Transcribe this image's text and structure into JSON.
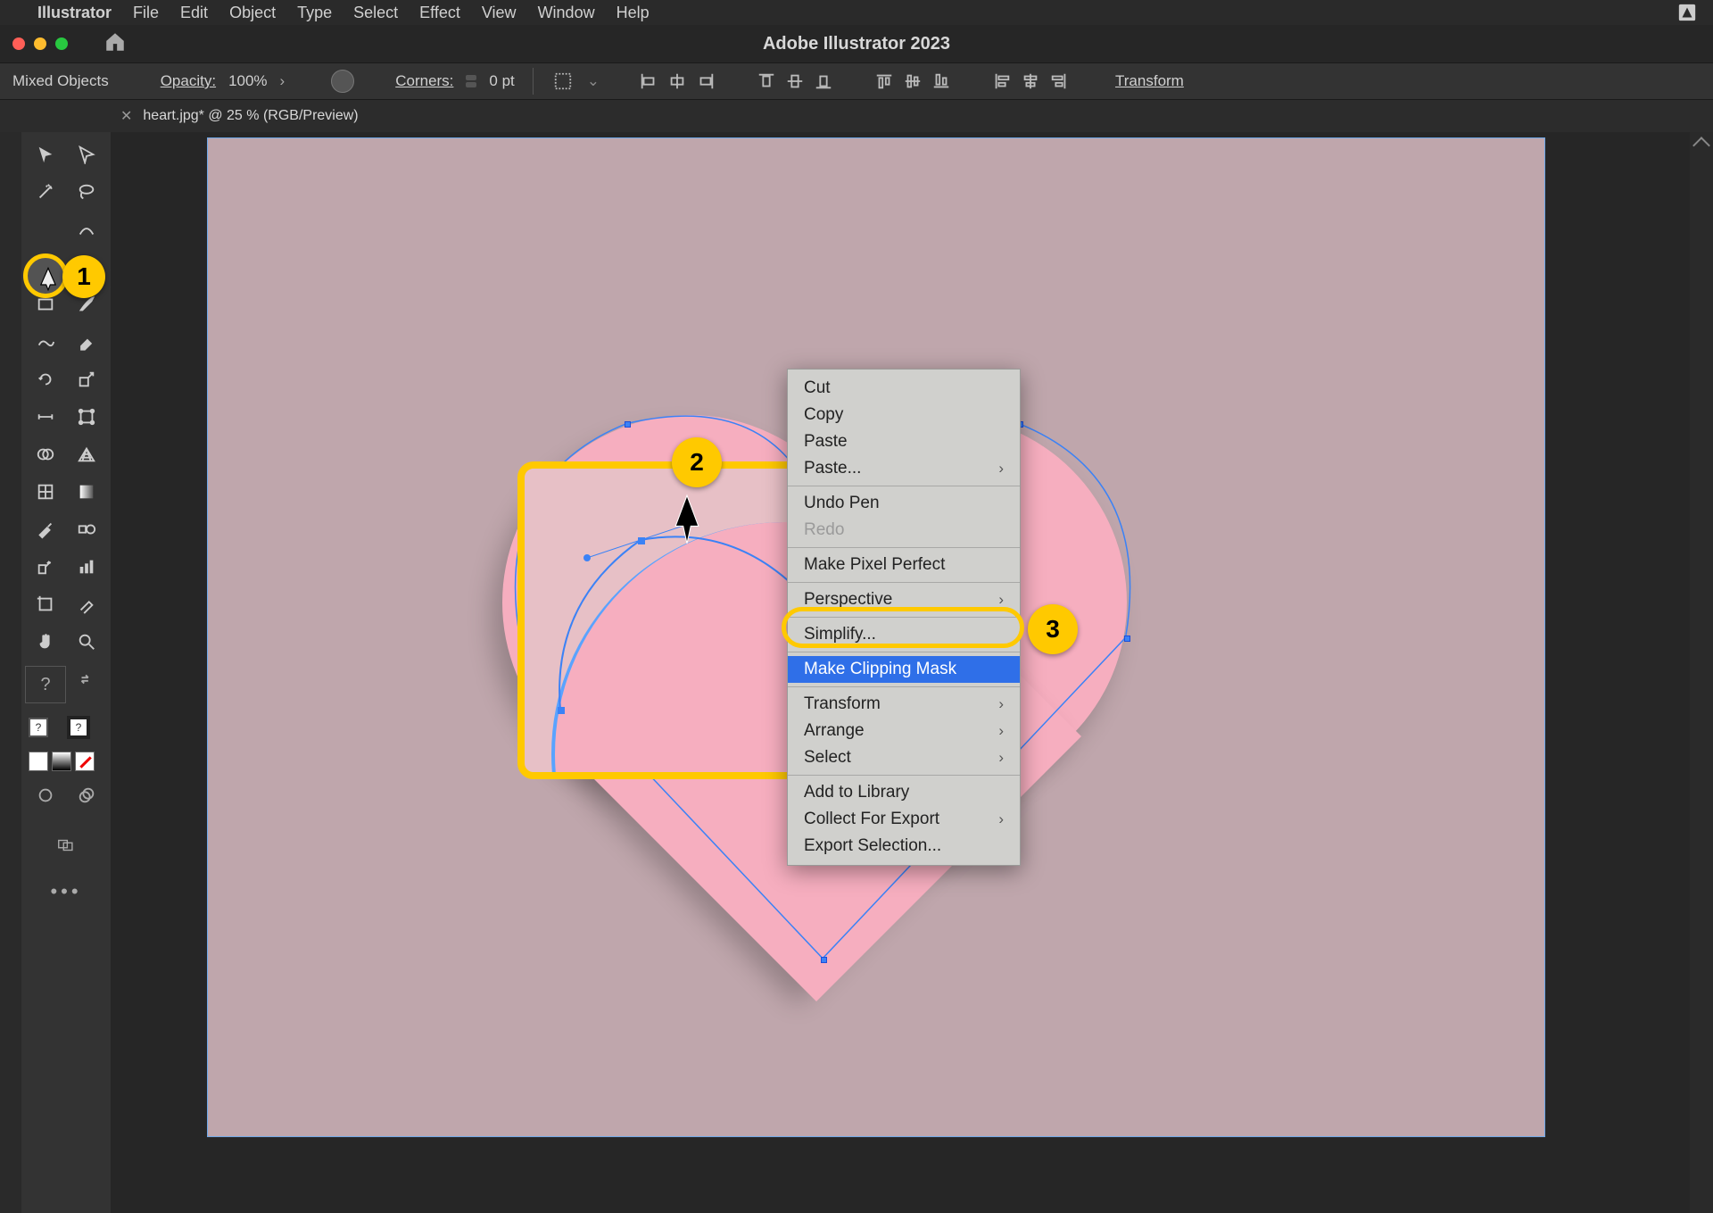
{
  "mac_menu": {
    "app_name": "Illustrator",
    "items": [
      "File",
      "Edit",
      "Object",
      "Type",
      "Select",
      "Effect",
      "View",
      "Window",
      "Help"
    ]
  },
  "window_title": "Adobe Illustrator 2023",
  "control_bar": {
    "selection": "Mixed Objects",
    "opacity_label": "Opacity:",
    "opacity_value": "100%",
    "corners_label": "Corners:",
    "corners_value": "0 pt",
    "transform_label": "Transform"
  },
  "document_tab": {
    "title": "heart.jpg* @ 25 % (RGB/Preview)"
  },
  "context_menu": {
    "cut": "Cut",
    "copy": "Copy",
    "paste": "Paste",
    "paste_special": "Paste...",
    "undo_pen": "Undo Pen",
    "redo": "Redo",
    "make_pixel_perfect": "Make Pixel Perfect",
    "perspective": "Perspective",
    "simplify": "Simplify...",
    "make_clipping_mask": "Make Clipping Mask",
    "transform": "Transform",
    "arrange": "Arrange",
    "select": "Select",
    "add_to_library": "Add to Library",
    "collect_for_export": "Collect For Export",
    "export_selection": "Export Selection..."
  },
  "annotations": {
    "a1": "1",
    "a2": "2",
    "a3": "3"
  }
}
